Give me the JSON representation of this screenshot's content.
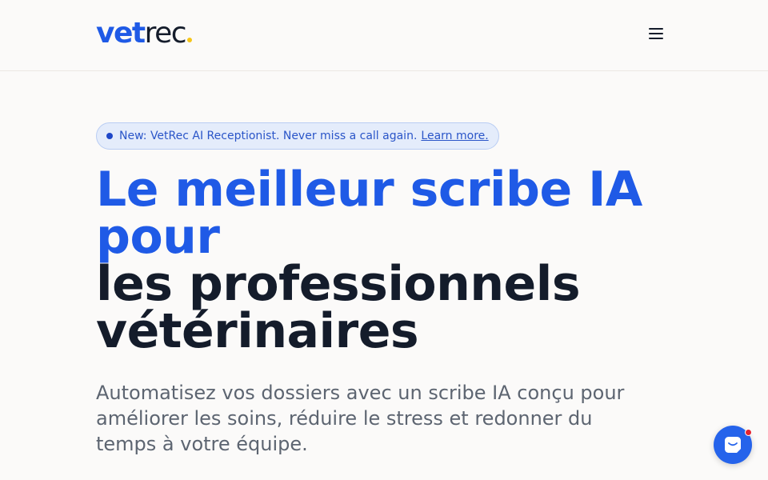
{
  "header": {
    "logo": {
      "part1": "vet",
      "part2": "rec"
    },
    "menu_icon": "hamburger-menu-icon"
  },
  "announcement": {
    "text": "New: VetRec AI Receptionist. Never miss a call again.",
    "link_label": "Learn more."
  },
  "hero": {
    "headline_line1": "Le meilleur scribe IA",
    "headline_line2": "pour",
    "headline_line3": "les professionnels",
    "headline_line4": "vétérinaires",
    "subtext": "Automatisez vos dossiers avec un scribe IA conçu pour améliorer les soins, réduire le stress et redonner du temps à votre équipe."
  },
  "chat": {
    "icon": "chat-bubble-icon"
  },
  "colors": {
    "brand_blue": "#1f5ae6",
    "dark_text": "#141c2b",
    "logo_dot": "#f5c518",
    "chat_button": "#2563eb",
    "notification_badge": "#e5232f"
  }
}
